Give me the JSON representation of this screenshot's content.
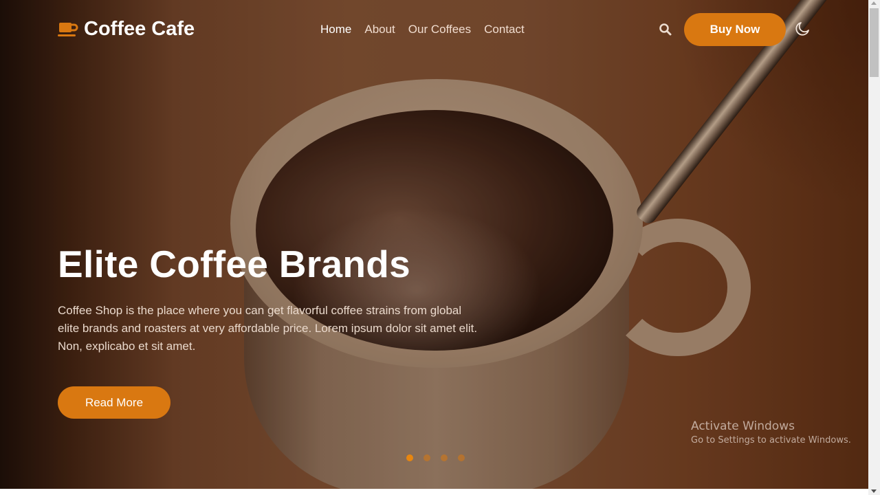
{
  "brand": {
    "name": "Coffee Cafe",
    "icon": "coffee-cup-icon",
    "accent_color": "#d97811"
  },
  "nav": {
    "links": [
      {
        "label": "Home",
        "active": true
      },
      {
        "label": "About",
        "active": false
      },
      {
        "label": "Our Coffees",
        "active": false
      },
      {
        "label": "Contact",
        "active": false
      }
    ],
    "search_icon": "search-icon",
    "buy_button": "Buy Now",
    "theme_icon": "moon-icon"
  },
  "hero": {
    "title": "Elite Coffee Brands",
    "description": "Coffee Shop is the place where you can get flavorful coffee strains from global elite brands and roasters at very affordable price. Lorem ipsum dolor sit amet elit. Non, explicabo et sit amet.",
    "cta_label": "Read More",
    "background_image": "coffee cup with spoon",
    "slides": {
      "count": 4,
      "active_index": 0
    }
  },
  "watermark": {
    "title": "Activate Windows",
    "subtitle": "Go to Settings to activate Windows."
  }
}
